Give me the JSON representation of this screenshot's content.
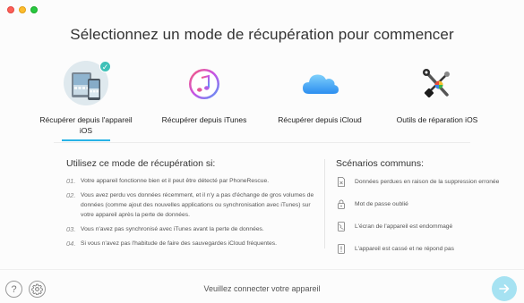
{
  "title": "Sélectionnez un mode de récupération pour commencer",
  "modes": [
    {
      "label": "Récupérer depuis l'appareil iOS",
      "icon": "ios-device-icon",
      "active": true
    },
    {
      "label": "Récupérer depuis iTunes",
      "icon": "itunes-icon",
      "active": false
    },
    {
      "label": "Récupérer depuis iCloud",
      "icon": "icloud-icon",
      "active": false
    },
    {
      "label": "Outils de réparation iOS",
      "icon": "repair-tools-icon",
      "active": false
    }
  ],
  "left": {
    "heading": "Utilisez ce mode de récupération si:",
    "steps": [
      {
        "num": "01.",
        "text": "Votre appareil fonctionne bien et il peut être détecté par PhoneRescue."
      },
      {
        "num": "02.",
        "text": "Vous avez perdu vos données récemment, et il n'y a pas d'échange de gros volumes de données (comme ajout des nouvelles applications ou synchronisation avec iTunes) sur votre appareil après la perte de données."
      },
      {
        "num": "03.",
        "text": "Vous n'avez pas synchronisé avec iTunes avant la perte de données."
      },
      {
        "num": "04.",
        "text": "Si vous n'avez pas l'habitude de faire des sauvegardes iCloud fréquentes."
      }
    ]
  },
  "right": {
    "heading": "Scénarios communs:",
    "items": [
      {
        "text": "Données perdues en raison de la suppression erronée",
        "icon": "deleted-file-icon"
      },
      {
        "text": "Mot de passe oublié",
        "icon": "lock-icon"
      },
      {
        "text": "L'écran de l'appareil est endommagé",
        "icon": "broken-screen-icon"
      },
      {
        "text": "L'appareil est cassé et ne répond pas",
        "icon": "warning-phone-icon"
      }
    ]
  },
  "footer": {
    "status": "Veuillez connecter votre appareil",
    "help_glyph": "?",
    "next_enabled": false
  },
  "colors": {
    "accent": "#29b3e6",
    "check": "#3fc1b8",
    "next_disabled": "#a6e2f2"
  }
}
